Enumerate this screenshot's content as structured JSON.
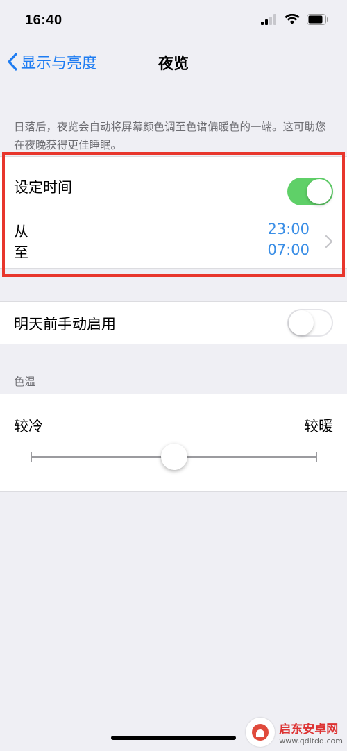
{
  "status_bar": {
    "time": "16:40"
  },
  "nav": {
    "back_label": "显示与亮度",
    "title": "夜览"
  },
  "description": "日落后，夜览会自动将屏幕颜色调至色谱偏暖色的一端。这可助您在夜晚获得更佳睡眠。",
  "schedule": {
    "label": "设定时间",
    "enabled": true,
    "from_label": "从",
    "to_label": "至",
    "from_time": "23:00",
    "to_time": "07:00"
  },
  "manual": {
    "label": "明天前手动启用",
    "enabled": false
  },
  "color_temperature": {
    "header": "色温",
    "cool_label": "较冷",
    "warm_label": "较暖",
    "value": 0.5
  },
  "watermark": {
    "name": "启东安卓网",
    "url": "www.qdltdq.com"
  },
  "colors": {
    "accent": "#1e7cf2",
    "toggle_on": "#5fd068",
    "highlight": "#e8362c"
  }
}
